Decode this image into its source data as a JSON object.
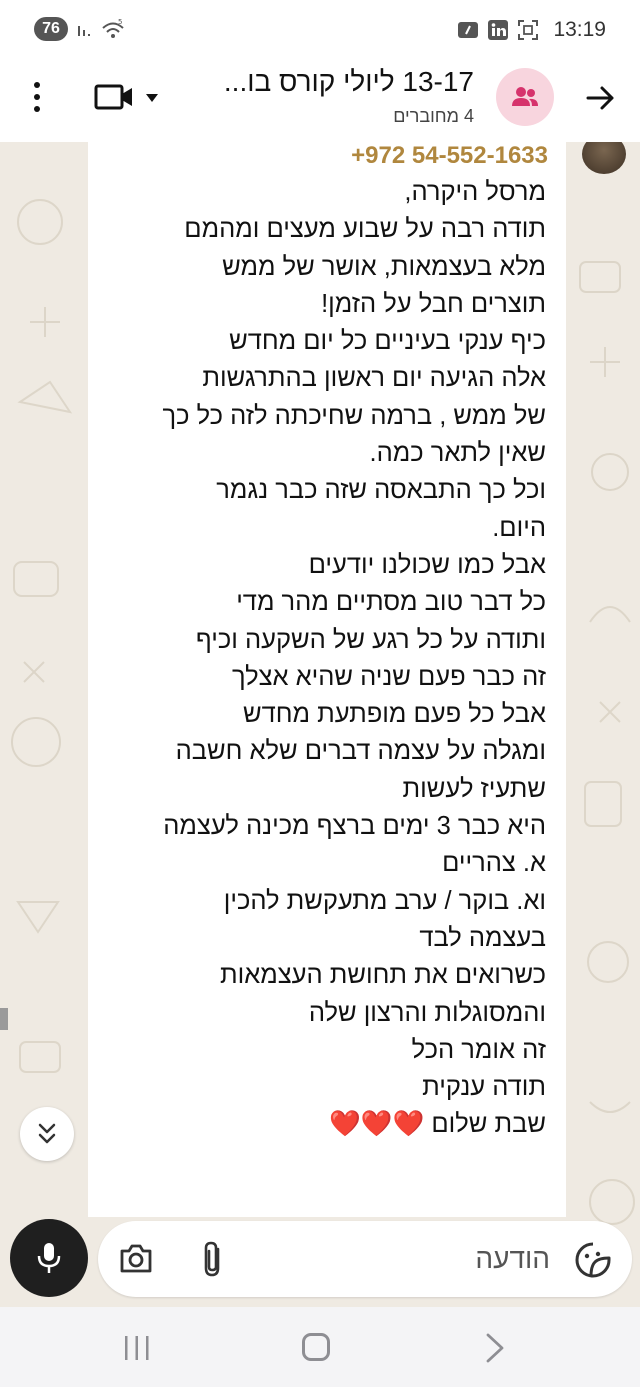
{
  "status_bar": {
    "battery": "76",
    "time": "13:19",
    "icons": [
      "signal-icon",
      "wifi-icon",
      "app-notification-icon",
      "linkedin-icon",
      "screenshot-icon"
    ]
  },
  "header": {
    "title": "13-17 ליולי  קורס בו...",
    "subtitle": "4 מחוברים",
    "icons": [
      "back-arrow-icon",
      "group-avatar-icon",
      "video-call-icon",
      "more-options-icon"
    ]
  },
  "message": {
    "sender": "+972 54-552-1633",
    "lines": [
      "מרסל היקרה,",
      "תודה רבה על שבוע מעצים ומהמם",
      "מלא בעצמאות, אושר של ממש",
      "תוצרים חבל על הזמן!",
      "כיף ענקי בעיניים כל יום מחדש",
      "אלה הגיעה יום ראשון בהתרגשות",
      "של ממש , ברמה שחיכתה לזה כל כך",
      "שאין לתאר כמה.",
      "וכל כך התבאסה שזה כבר נגמר",
      "היום.",
      "אבל כמו שכולנו יודעים",
      "כל דבר טוב מסתיים מהר מדי",
      "ותודה על כל רגע של השקעה וכיף",
      "זה כבר פעם שניה שהיא אצלך",
      "אבל כל פעם מופתעת מחדש",
      "ומגלה על עצמה דברים שלא חשבה",
      "שתעיז לעשות",
      "היא כבר 3 ימים ברצף מכינה לעצמה",
      "א. צהריים",
      "וא. בוקר / ערב מתעקשת להכין",
      "בעצמה לבד",
      "כשרואים את תחושת העצמאות",
      "והמסוגלות והרצון שלה",
      "זה אומר הכל",
      "תודה ענקית",
      "שבת שלום ❤️❤️❤️"
    ]
  },
  "input": {
    "placeholder": "הודעה",
    "icons": [
      "mic-icon",
      "camera-icon",
      "attach-icon",
      "emoji-sticker-icon"
    ]
  },
  "colors": {
    "sender_name": "#b0873e",
    "chat_background": "#efeae2",
    "group_avatar_bg": "#f8d5de",
    "group_avatar_fg": "#d6336c",
    "mic_button": "#1f1f1f"
  }
}
